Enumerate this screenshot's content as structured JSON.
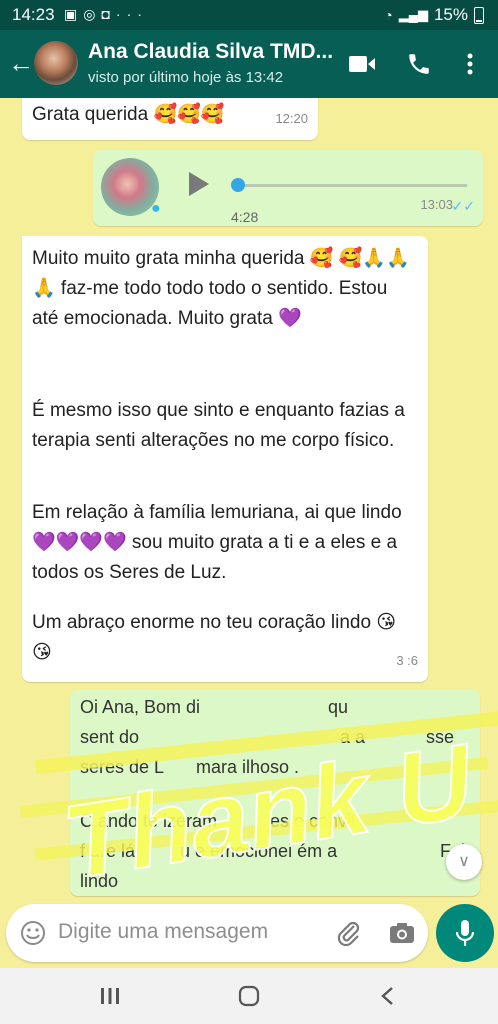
{
  "status": {
    "time": "14:23",
    "battery": "15%",
    "icons": [
      "gallery-icon",
      "whatsapp-icon",
      "instagram-icon",
      "more-icon"
    ]
  },
  "contact": {
    "name": "Ana Claudia Silva TMD...",
    "last_seen": "visto por último hoje às 13:42"
  },
  "messages": [
    {
      "type": "text",
      "direction": "in",
      "text": "Grata querida 🥰🥰🥰",
      "time": "12:20"
    },
    {
      "type": "voice",
      "direction": "out",
      "duration": "4:28",
      "time": "13:03",
      "ticks": "✓✓"
    },
    {
      "type": "text",
      "direction": "in",
      "paragraphs": [
        "Muito muito grata minha querida 🥰 🥰🙏🙏🙏 faz-me todo todo todo o sentido. Estou até emocionada. Muito grata 💜",
        "É mesmo isso que sinto e enquanto fazias a terapia senti alterações no me corpo físico.",
        "Em relação à família lemuriana, ai que lindo 💜💜💜💜 sou muito grata a ti e a eles e a todos os Seres de Luz.",
        "Um abraço enorme no teu coração lindo 😘😘"
      ],
      "time": "3 :6"
    },
    {
      "type": "text",
      "direction": "out",
      "partial": true,
      "lines": [
        "Oi Ana, Bom di",
        "qu",
        "sent do",
        "a a",
        "sse",
        "seres de L",
        "mara ilhoso .",
        "C ando te izeram",
        "es e convit",
        "f ure lá",
        "u  e emocionei  ém a",
        "Foi",
        "lindo"
      ]
    }
  ],
  "overlay": {
    "text": "Thank U"
  },
  "input": {
    "placeholder": "Digite uma mensagem"
  },
  "colors": {
    "header": "#075e54",
    "statusbar": "#064c43",
    "accent": "#00897b",
    "wallpaper": "#f6ef9a",
    "bubble_out": "#dcf8c6",
    "read_ticks": "#4fc3f7"
  }
}
